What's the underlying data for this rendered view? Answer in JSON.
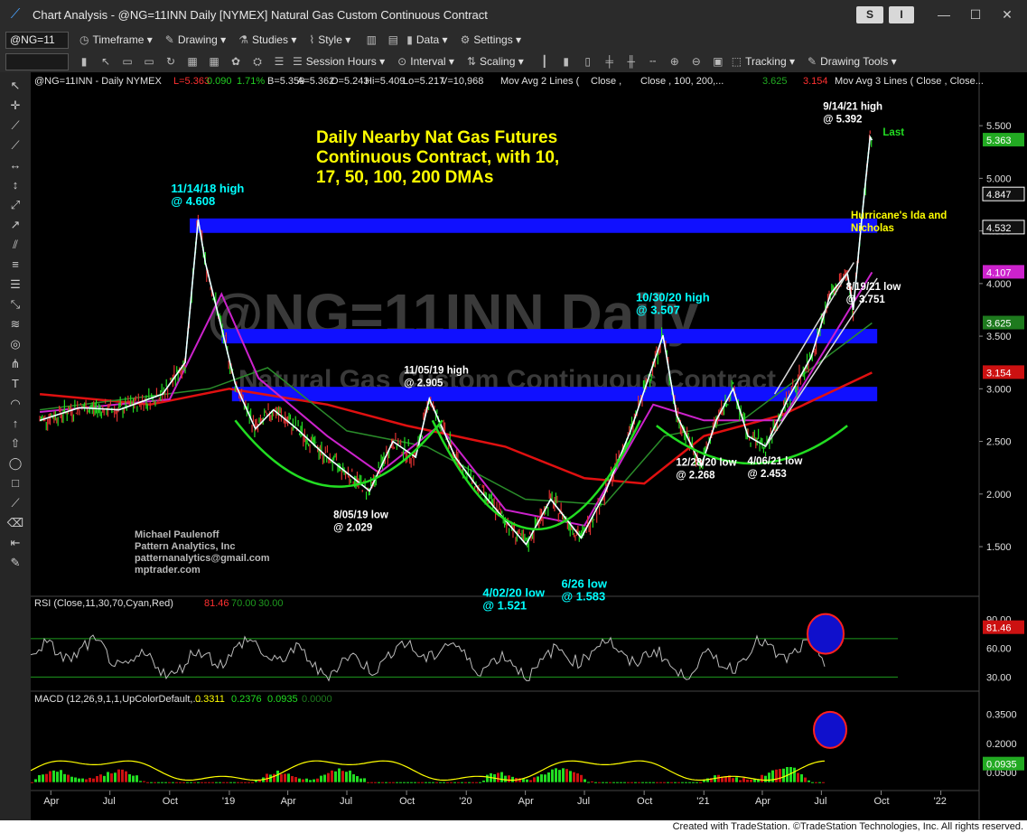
{
  "window": {
    "title": "Chart Analysis - @NG=11INN Daily [NYMEX] Natural Gas Custom Continuous Contract",
    "s_button": "S",
    "i_button": "I"
  },
  "toolbar1": {
    "symbol": "@NG=11",
    "timeframe": "Timeframe",
    "drawing": "Drawing",
    "studies": "Studies",
    "style": "Style",
    "data": "Data",
    "settings": "Settings"
  },
  "toolbar2": {
    "session_hours": "Session Hours",
    "interval": "Interval",
    "scaling": "Scaling",
    "tracking": "Tracking",
    "drawing_tools": "Drawing Tools"
  },
  "chart_data": [
    {
      "type": "line",
      "panel": "price",
      "title": "Daily Nearby Nat Gas Futures Continuous Contract, with 10, 17, 50, 100, 200 DMAs",
      "title_lines": [
        "Daily Nearby Nat Gas Futures",
        "Continuous Contract, with 10,",
        "17, 50, 100, 200 DMAs"
      ],
      "header": "@NG=11INN - Daily  NYMEX",
      "header_fields": [
        "L=5.363",
        "0.090",
        "1.71%",
        "B=5.359",
        "A=5.362",
        "O=5.243",
        "Hi=5.409",
        "Lo=5.217",
        "V=10,968",
        "Mov Avg 2 Lines (",
        "Close ,",
        "Close , 100, 200,...",
        "3.625",
        "3.154",
        "Mov Avg 3 Lines ( Close , Close..."
      ],
      "watermark": [
        "@NG=11INN Daily",
        "Natural Gas Custom Continuous Contract"
      ],
      "x_ticks": [
        "Apr",
        "Jul",
        "Oct",
        "'19",
        "Apr",
        "Jul",
        "Oct",
        "'20",
        "Apr",
        "Jul",
        "Oct",
        "'21",
        "Apr",
        "Jul",
        "Oct",
        "'22"
      ],
      "y_ticks": [
        1.5,
        2.0,
        2.5,
        3.0,
        3.5,
        4.0,
        4.5,
        5.0,
        5.5
      ],
      "y_tick_labels": [
        "1.500",
        "2.000",
        "2.500",
        "3.000",
        "3.500",
        "4.000",
        "4.500",
        "5.000",
        "5.500"
      ],
      "ylim": [
        1.2,
        5.75
      ],
      "axis_badges": [
        {
          "label": "5.363",
          "value": 5.363,
          "color": "#22aa22"
        },
        {
          "label": "4.847",
          "value": 4.847,
          "color": "#ffffff"
        },
        {
          "label": "4.532",
          "value": 4.532,
          "color": "#ffffff"
        },
        {
          "label": "4.107",
          "value": 4.107,
          "color": "#cc22cc"
        },
        {
          "label": "3.625",
          "value": 3.625,
          "color": "#1e7a1e"
        },
        {
          "label": "3.154",
          "value": 3.154,
          "color": "#cc1111"
        }
      ],
      "series_colors": {
        "price": "#8cd4e8",
        "ma10": "#ffffff",
        "ma17": "#00ffff",
        "ma50": "#cc22cc",
        "ma100": "#2a8c2a",
        "ma200": "#e01010"
      },
      "close_points": [
        {
          "x": "2018-03-15",
          "y": 2.7
        },
        {
          "x": "2018-05-15",
          "y": 2.82
        },
        {
          "x": "2018-07-15",
          "y": 2.8
        },
        {
          "x": "2018-09-20",
          "y": 2.95
        },
        {
          "x": "2018-10-25",
          "y": 3.25
        },
        {
          "x": "2018-11-14",
          "y": 4.608
        },
        {
          "x": "2018-11-25",
          "y": 4.2
        },
        {
          "x": "2018-12-15",
          "y": 3.7
        },
        {
          "x": "2019-01-10",
          "y": 3.05
        },
        {
          "x": "2019-02-10",
          "y": 2.62
        },
        {
          "x": "2019-03-10",
          "y": 2.8
        },
        {
          "x": "2019-04-15",
          "y": 2.62
        },
        {
          "x": "2019-06-01",
          "y": 2.35
        },
        {
          "x": "2019-08-05",
          "y": 2.029
        },
        {
          "x": "2019-09-10",
          "y": 2.5
        },
        {
          "x": "2019-10-15",
          "y": 2.35
        },
        {
          "x": "2019-11-05",
          "y": 2.905
        },
        {
          "x": "2019-12-15",
          "y": 2.35
        },
        {
          "x": "2020-01-20",
          "y": 2.05
        },
        {
          "x": "2020-03-01",
          "y": 1.75
        },
        {
          "x": "2020-04-02",
          "y": 1.521
        },
        {
          "x": "2020-05-10",
          "y": 1.95
        },
        {
          "x": "2020-06-26",
          "y": 1.583
        },
        {
          "x": "2020-08-01",
          "y": 2.0
        },
        {
          "x": "2020-09-10",
          "y": 2.6
        },
        {
          "x": "2020-10-30",
          "y": 3.507
        },
        {
          "x": "2020-11-20",
          "y": 2.75
        },
        {
          "x": "2020-12-28",
          "y": 2.268
        },
        {
          "x": "2021-01-20",
          "y": 2.7
        },
        {
          "x": "2021-02-15",
          "y": 3.0
        },
        {
          "x": "2021-03-10",
          "y": 2.55
        },
        {
          "x": "2021-04-06",
          "y": 2.453
        },
        {
          "x": "2021-05-10",
          "y": 2.9
        },
        {
          "x": "2021-06-15",
          "y": 3.3
        },
        {
          "x": "2021-07-15",
          "y": 3.9
        },
        {
          "x": "2021-08-10",
          "y": 4.1
        },
        {
          "x": "2021-08-19",
          "y": 3.751
        },
        {
          "x": "2021-09-01",
          "y": 4.6
        },
        {
          "x": "2021-09-14",
          "y": 5.392
        },
        {
          "x": "2021-09-17",
          "y": 5.363
        }
      ],
      "ma200_points": [
        {
          "x": "2018-03-15",
          "y": 2.95
        },
        {
          "x": "2018-09-01",
          "y": 2.85
        },
        {
          "x": "2019-01-01",
          "y": 3.0
        },
        {
          "x": "2019-06-01",
          "y": 2.85
        },
        {
          "x": "2019-10-01",
          "y": 2.65
        },
        {
          "x": "2020-03-01",
          "y": 2.45
        },
        {
          "x": "2020-07-01",
          "y": 2.15
        },
        {
          "x": "2020-10-01",
          "y": 2.1
        },
        {
          "x": "2021-01-01",
          "y": 2.55
        },
        {
          "x": "2021-05-01",
          "y": 2.75
        },
        {
          "x": "2021-09-17",
          "y": 3.154
        }
      ],
      "ma100_points": [
        {
          "x": "2018-03-15",
          "y": 2.8
        },
        {
          "x": "2018-12-01",
          "y": 3.0
        },
        {
          "x": "2019-03-01",
          "y": 3.2
        },
        {
          "x": "2019-07-01",
          "y": 2.6
        },
        {
          "x": "2019-11-01",
          "y": 2.45
        },
        {
          "x": "2020-04-01",
          "y": 1.95
        },
        {
          "x": "2020-08-01",
          "y": 1.9
        },
        {
          "x": "2020-11-01",
          "y": 2.55
        },
        {
          "x": "2021-03-01",
          "y": 2.7
        },
        {
          "x": "2021-09-17",
          "y": 3.625
        }
      ],
      "ma50_points": [
        {
          "x": "2018-03-15",
          "y": 2.78
        },
        {
          "x": "2018-10-01",
          "y": 2.9
        },
        {
          "x": "2018-12-20",
          "y": 3.9
        },
        {
          "x": "2019-02-15",
          "y": 3.1
        },
        {
          "x": "2019-06-01",
          "y": 2.55
        },
        {
          "x": "2019-08-20",
          "y": 2.2
        },
        {
          "x": "2019-11-20",
          "y": 2.65
        },
        {
          "x": "2020-03-01",
          "y": 1.85
        },
        {
          "x": "2020-07-01",
          "y": 1.7
        },
        {
          "x": "2020-10-15",
          "y": 2.85
        },
        {
          "x": "2021-01-01",
          "y": 2.7
        },
        {
          "x": "2021-05-01",
          "y": 2.7
        },
        {
          "x": "2021-09-17",
          "y": 4.107
        }
      ],
      "channels": [
        {
          "value": 4.55,
          "start": "2018-11-01",
          "end": "2021-09-25"
        },
        {
          "value": 3.5,
          "start": "2018-12-20",
          "end": "2021-09-25"
        },
        {
          "value": 2.95,
          "start": "2019-01-05",
          "end": "2021-09-25"
        }
      ],
      "annotations": [
        {
          "lines": [
            "11/14/18 high",
            "@ 4.608"
          ],
          "x": "2018-11-14",
          "y": 4.608,
          "color": "#00ffff"
        },
        {
          "lines": [
            "8/05/19 low",
            "@ 2.029"
          ],
          "x": "2019-08-05",
          "y": 2.029,
          "color": "#ffffff"
        },
        {
          "lines": [
            "11/05/19 high",
            "@ 2.905"
          ],
          "x": "2019-11-05",
          "y": 2.905,
          "color": "#ffffff"
        },
        {
          "lines": [
            "4/02/20 low",
            "@ 1.521"
          ],
          "x": "2020-04-02",
          "y": 1.521,
          "color": "#00ffff"
        },
        {
          "lines": [
            "6/26 low",
            "@ 1.583"
          ],
          "x": "2020-06-26",
          "y": 1.583,
          "color": "#00ffff"
        },
        {
          "lines": [
            "10/30/20 high",
            "@ 3.507"
          ],
          "x": "2020-10-30",
          "y": 3.507,
          "color": "#00ffff"
        },
        {
          "lines": [
            "12/28/20 low",
            "@ 2.268"
          ],
          "x": "2020-12-28",
          "y": 2.268,
          "color": "#ffffff"
        },
        {
          "lines": [
            "4/06/21 low",
            "@ 2.453"
          ],
          "x": "2021-04-06",
          "y": 2.453,
          "color": "#ffffff"
        },
        {
          "lines": [
            "8/19/21 low",
            "@ 3.751"
          ],
          "x": "2021-08-19",
          "y": 3.751,
          "color": "#ffffff"
        },
        {
          "lines": [
            "9/14/21 high",
            "@ 5.392"
          ],
          "x": "2021-09-14",
          "y": 5.392,
          "color": "#ffffff"
        },
        {
          "lines": [
            "Last"
          ],
          "x": "2021-09-17",
          "y": 5.363,
          "color": "#22dd22"
        },
        {
          "lines": [
            "Hurricane's Ida and",
            "Nicholas"
          ],
          "x": "2021-09-25",
          "y": 4.55,
          "color": "#ffff00"
        }
      ],
      "credit": [
        "Michael Paulenoff",
        "Pattern Analytics, Inc",
        "patternanalytics@gmail.com",
        "mptrader.com"
      ]
    },
    {
      "type": "line",
      "panel": "rsi",
      "header": "RSI (Close,11,30,70,Cyan,Red)",
      "values_shown": [
        {
          "label": "81.46",
          "color": "#ff3030"
        },
        {
          "label": "70.00",
          "color": "#1e9a1e"
        },
        {
          "label": "30.00",
          "color": "#1e9a1e"
        }
      ],
      "y_ticks": [
        30,
        60,
        90
      ],
      "y_tick_labels": [
        "30.00",
        "60.00",
        "90.00"
      ],
      "badge": {
        "label": "81.46",
        "value": 81.46
      },
      "ylim": [
        20,
        100
      ],
      "levels": [
        70,
        30
      ],
      "last": 81.46
    },
    {
      "type": "bar",
      "panel": "macd",
      "header": "MACD (12,26,9,1,1,UpColorDefault,...",
      "values_shown": [
        {
          "label": "0.3311",
          "color": "#ffff00"
        },
        {
          "label": "0.2376",
          "color": "#22dd22"
        },
        {
          "label": "0.0935",
          "color": "#22dd22"
        },
        {
          "label": "0.0000",
          "color": "#1e7a1e"
        }
      ],
      "y_ticks": [
        0.05,
        0.1,
        0.2,
        0.35
      ],
      "y_tick_labels": [
        "0.0500",
        "0.1000",
        "0.2000",
        "0.3500"
      ],
      "badge": {
        "label": "0.0935",
        "value": 0.0935
      },
      "ylim": [
        -0.02,
        0.4
      ],
      "last": {
        "macd": 0.3311,
        "signal": 0.2376,
        "hist": 0.0935
      }
    }
  ],
  "footer": "Created with TradeStation. ©TradeStation Technologies, Inc. All rights reserved."
}
